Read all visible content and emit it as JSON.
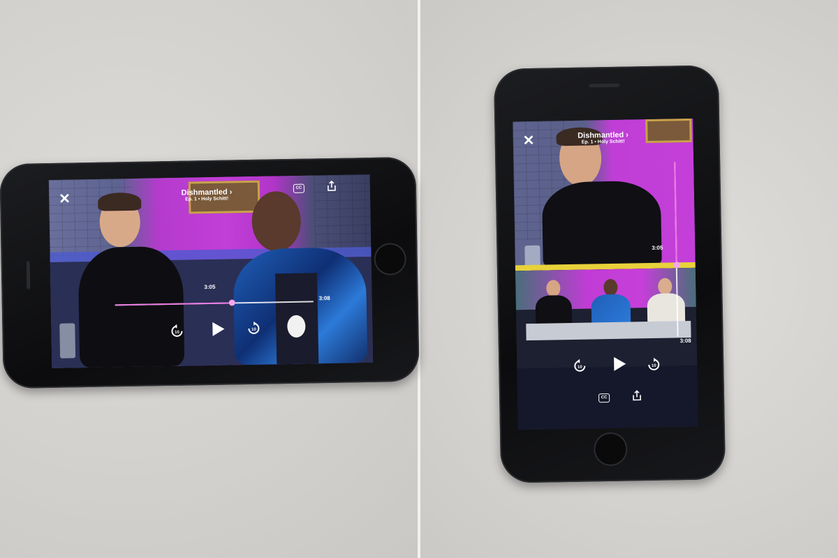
{
  "player": {
    "show_title": "Dishmantled",
    "chevron": "›",
    "episode": "Ep. 1 • Holy Schitt!",
    "close_label": "✕",
    "cc_label": "CC",
    "current_time": "3:05",
    "total_time": "3:08",
    "progress_fraction": 0.59,
    "skip_back_seconds": "10",
    "skip_forward_seconds": "10"
  },
  "colors": {
    "accent": "#e879e0",
    "backdrop_magenta": "#c23ed8"
  },
  "icons": [
    "close-icon",
    "closed-captions-icon",
    "share-icon",
    "skip-back-10-icon",
    "play-icon",
    "skip-forward-10-icon"
  ]
}
